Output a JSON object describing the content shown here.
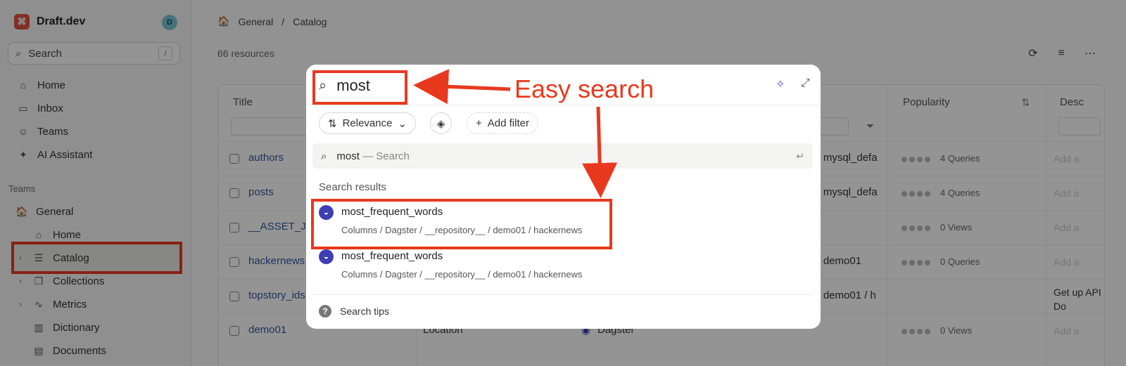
{
  "app": {
    "name": "Draft.dev",
    "avatar_initial": "D"
  },
  "sidebar": {
    "search": {
      "label": "Search",
      "shortcut": "/"
    },
    "items": [
      {
        "label": "Home",
        "icon": "home-icon"
      },
      {
        "label": "Inbox",
        "icon": "inbox-icon"
      },
      {
        "label": "Teams",
        "icon": "teams-icon"
      },
      {
        "label": "AI Assistant",
        "icon": "sparkle-icon"
      }
    ],
    "teams_label": "Teams",
    "team": {
      "label": "General"
    },
    "team_items": [
      {
        "label": "Home"
      },
      {
        "label": "Catalog"
      },
      {
        "label": "Collections"
      },
      {
        "label": "Metrics"
      },
      {
        "label": "Dictionary"
      },
      {
        "label": "Documents"
      }
    ]
  },
  "main": {
    "breadcrumb": [
      "General",
      "/",
      "Catalog"
    ],
    "resource_count": "66 resources",
    "columns": {
      "title": "Title",
      "popularity": "Popularity",
      "description": "Desc"
    },
    "rows": [
      {
        "name": "authors",
        "path": "g / mysql_defa",
        "popularity": "4 Queries",
        "desc": "Add a"
      },
      {
        "name": "posts",
        "path": "g / mysql_defa",
        "popularity": "4 Queries",
        "desc": "Add a"
      },
      {
        "name": "__ASSET_JO",
        "path": "",
        "popularity": "0 Views",
        "desc": "Add a"
      },
      {
        "name": "hackernews",
        "path": "_ / demo01",
        "popularity": "0 Queries",
        "desc": "Add a"
      },
      {
        "name": "topstory_ids",
        "path": "_ / demo01 / h",
        "popularity": "",
        "desc": "Get up API Do"
      },
      {
        "name": "demo01",
        "type": "Location",
        "source": "Dagster",
        "path": "",
        "popularity": "0 Views",
        "desc": "Add a"
      }
    ]
  },
  "modal": {
    "query": "most",
    "sort_label": "Relevance",
    "add_filter_label": "Add filter",
    "suggestion": {
      "query": "most",
      "suffix": "— Search"
    },
    "results_label": "Search results",
    "results": [
      {
        "title": "most_frequent_words",
        "path": "Columns / Dagster / __repository__ / demo01 / hackernews"
      },
      {
        "title": "most_frequent_words",
        "path": "Columns / Dagster / __repository__ / demo01 / hackernews"
      }
    ],
    "tips_label": "Search tips"
  },
  "annotation": {
    "text": "Easy search",
    "color": "#e8391f"
  }
}
